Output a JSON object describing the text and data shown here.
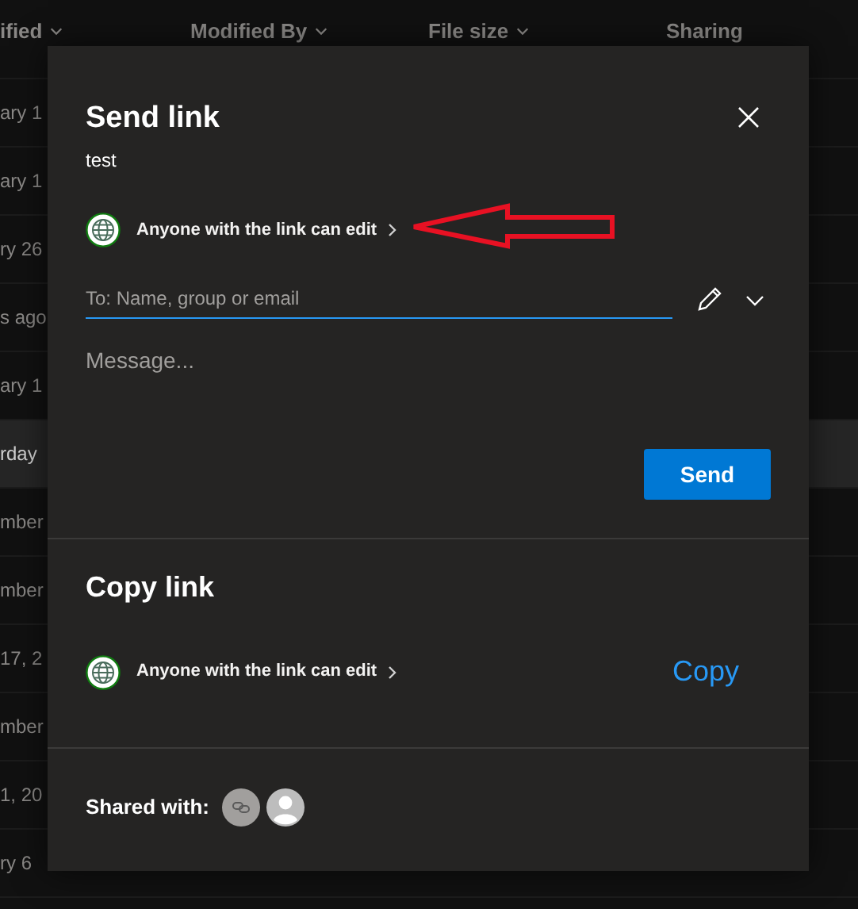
{
  "file_list": {
    "columns": [
      {
        "label": "ified",
        "sort_menu": true
      },
      {
        "label": "Modified By",
        "sort_menu": true
      },
      {
        "label": "File size",
        "sort_menu": true
      },
      {
        "label": "Sharing",
        "sort_menu": false
      }
    ],
    "rows": [
      {
        "modified": "ary 1",
        "selected": false
      },
      {
        "modified": "ary 1",
        "selected": false
      },
      {
        "modified": "ry 26",
        "selected": false
      },
      {
        "modified": "s ago",
        "selected": false
      },
      {
        "modified": "ary 1",
        "selected": false
      },
      {
        "modified": "rday",
        "selected": true
      },
      {
        "modified": "mber",
        "selected": false
      },
      {
        "modified": "mber",
        "selected": false
      },
      {
        "modified": "17, 2",
        "selected": false
      },
      {
        "modified": "mber",
        "selected": false
      },
      {
        "modified": "1, 20",
        "selected": false
      },
      {
        "modified": "ry 6",
        "selected": false
      }
    ]
  },
  "dialog": {
    "send_link": {
      "title": "Send link",
      "file_name": "test",
      "permission": "Anyone with the link can edit",
      "recipient_placeholder": "To: Name, group or email",
      "message_placeholder": "Message...",
      "send_button": "Send"
    },
    "copy_link": {
      "title": "Copy link",
      "permission": "Anyone with the link can edit",
      "copy_button": "Copy"
    },
    "shared_with": {
      "label": "Shared with:",
      "avatars": [
        {
          "kind": "link"
        },
        {
          "kind": "person"
        }
      ]
    }
  }
}
